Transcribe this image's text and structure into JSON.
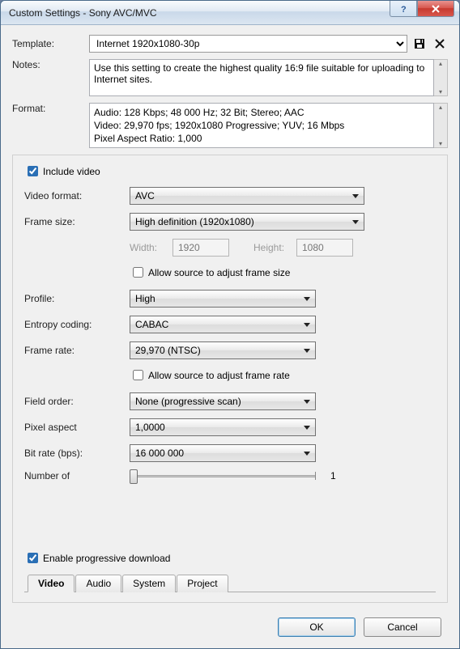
{
  "window": {
    "title": "Custom Settings - Sony AVC/MVC"
  },
  "template": {
    "label": "Template:",
    "value": "Internet 1920x1080-30p",
    "save_icon": "save-icon",
    "delete_icon": "delete-icon"
  },
  "notes": {
    "label": "Notes:",
    "text": "Use this setting to create the highest quality 16:9 file suitable for uploading to Internet sites."
  },
  "format": {
    "label": "Format:",
    "line1": "Audio: 128 Kbps; 48 000 Hz; 32 Bit; Stereo; AAC",
    "line2": "Video: 29,970 fps; 1920x1080 Progressive; YUV; 16 Mbps",
    "line3": "Pixel Aspect Ratio: 1,000"
  },
  "video": {
    "include_label": "Include video",
    "include_checked": true,
    "format_label": "Video format:",
    "format_value": "AVC",
    "frame_size_label": "Frame size:",
    "frame_size_value": "High definition (1920x1080)",
    "width_label": "Width:",
    "width_value": "1920",
    "height_label": "Height:",
    "height_value": "1080",
    "allow_size_label": "Allow source to adjust frame size",
    "profile_label": "Profile:",
    "profile_value": "High",
    "entropy_label": "Entropy coding:",
    "entropy_value": "CABAC",
    "framerate_label": "Frame rate:",
    "framerate_value": "29,970 (NTSC)",
    "allow_rate_label": "Allow source to adjust frame rate",
    "field_order_label": "Field order:",
    "field_order_value": "None (progressive scan)",
    "pixel_aspect_label": "Pixel aspect",
    "pixel_aspect_value": "1,0000",
    "bitrate_label": "Bit rate (bps):",
    "bitrate_value": "16 000 000",
    "numberof_label": "Number of",
    "numberof_value": "1",
    "progressive_label": "Enable progressive download",
    "progressive_checked": true
  },
  "tabs": {
    "video": "Video",
    "audio": "Audio",
    "system": "System",
    "project": "Project"
  },
  "footer": {
    "ok": "OK",
    "cancel": "Cancel"
  }
}
